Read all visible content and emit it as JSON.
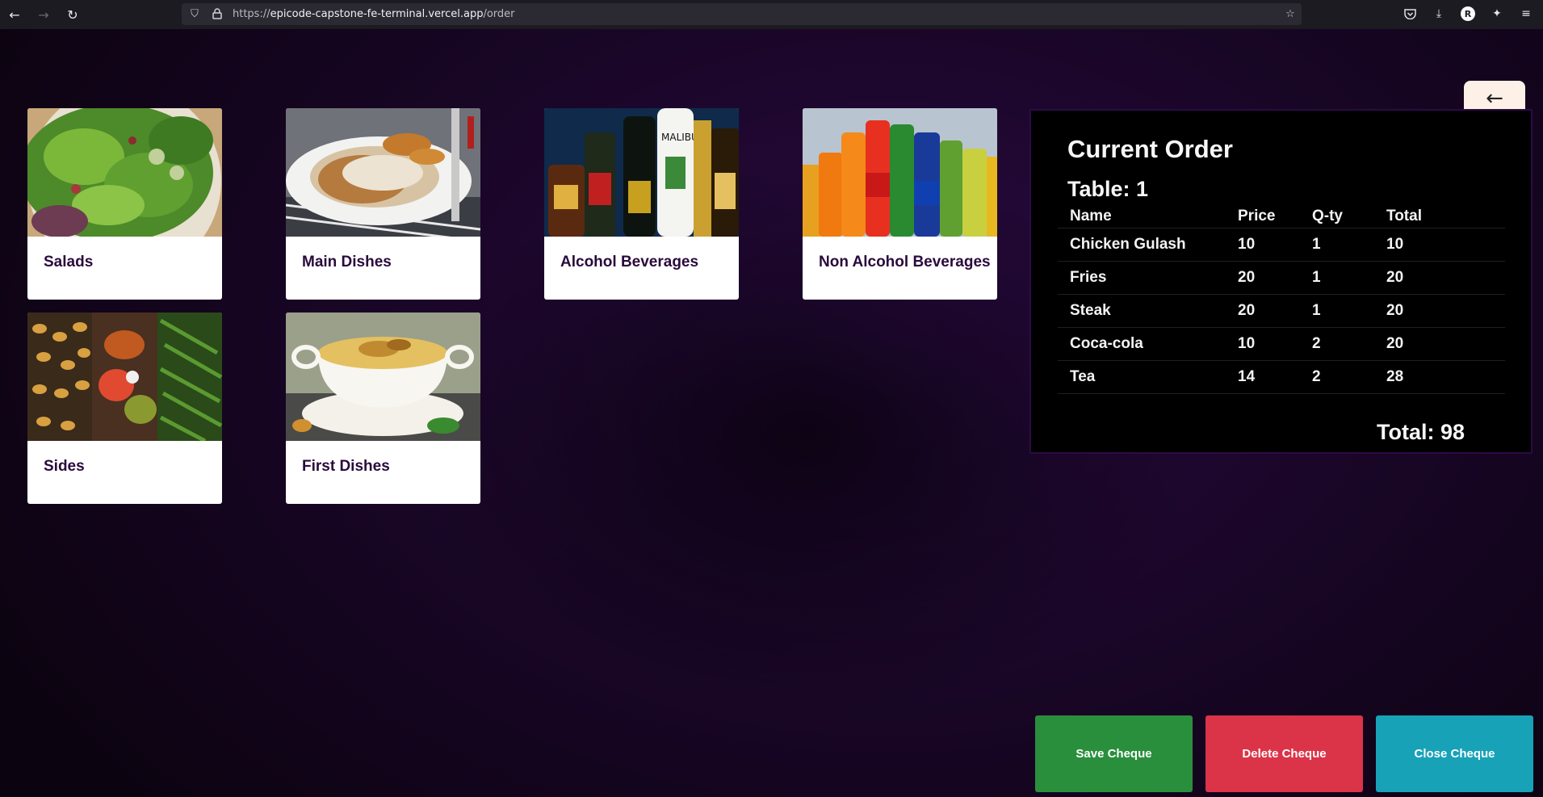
{
  "browser": {
    "url_prefix": "https://",
    "url_host": "epicode-capstone-fe-terminal.vercel.app",
    "url_path": "/order",
    "profile_initial": "R"
  },
  "page": {
    "back_icon": "←",
    "categories": [
      {
        "label": "Salads",
        "icon": "salad-image"
      },
      {
        "label": "Main Dishes",
        "icon": "main-dish-image"
      },
      {
        "label": "Alcohol Beverages",
        "icon": "alcohol-bottles-image"
      },
      {
        "label": "Non Alcohol Beverages",
        "icon": "soda-bottles-image"
      },
      {
        "label": "Sides",
        "icon": "sides-image"
      },
      {
        "label": "First Dishes",
        "icon": "soup-image"
      }
    ]
  },
  "order": {
    "title": "Current Order",
    "table_label": "Table: 1",
    "columns": {
      "name": "Name",
      "price": "Price",
      "qty": "Q-ty",
      "total": "Total"
    },
    "items": [
      {
        "name": "Chicken Gulash",
        "price": "10",
        "qty": "1",
        "total": "10"
      },
      {
        "name": "Fries",
        "price": "20",
        "qty": "1",
        "total": "20"
      },
      {
        "name": "Steak",
        "price": "20",
        "qty": "1",
        "total": "20"
      },
      {
        "name": "Coca-cola",
        "price": "10",
        "qty": "2",
        "total": "20"
      },
      {
        "name": "Tea",
        "price": "14",
        "qty": "2",
        "total": "28"
      }
    ],
    "grand_total": "Total: 98"
  },
  "actions": {
    "save": "Save Cheque",
    "delete": "Delete Cheque",
    "close": "Close Cheque"
  },
  "colors": {
    "save": "#2a8f3c",
    "delete": "#db3448",
    "close": "#17a2b8",
    "card_label": "#2a0a3c"
  }
}
